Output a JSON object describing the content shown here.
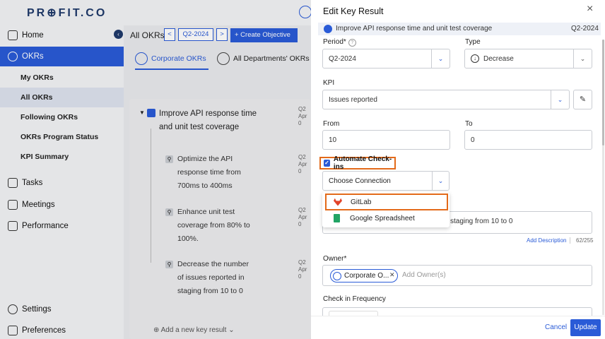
{
  "brand": {
    "logo": "PR⊕FIT.CO"
  },
  "sidebar": {
    "items": [
      {
        "label": "Home",
        "icon": "home-icon"
      },
      {
        "label": "OKRs",
        "icon": "target-icon",
        "active": true
      },
      {
        "label": "Tasks",
        "icon": "tasks-icon"
      },
      {
        "label": "Meetings",
        "icon": "calendar-icon"
      },
      {
        "label": "Performance",
        "icon": "chart-icon"
      },
      {
        "label": "Settings",
        "icon": "gear-icon"
      },
      {
        "label": "Preferences",
        "icon": "sliders-icon"
      }
    ],
    "sub_items": [
      "My OKRs",
      "All OKRs",
      "Following OKRs",
      "OKRs Program Status",
      "KPI Summary"
    ],
    "selected_sub": "All OKRs"
  },
  "main": {
    "title": "All OKRs",
    "prev": "<",
    "quarter": "Q2-2024",
    "next": ">",
    "create_label": "+ Create Objective",
    "tabs": [
      "Corporate OKRs",
      "All Departments' OKRs"
    ],
    "objective": "Improve API response time and unit test coverage",
    "key_results": [
      "Optimize the API response time from 700ms to 400ms",
      "Enhance unit test coverage from 80% to 100%.",
      "Decrease the number of issues reported in staging from 10 to 0"
    ],
    "quarter_short": "Q2",
    "date_short": "Apr 0",
    "add_kr": "Add a new key result"
  },
  "modal": {
    "title": "Edit Key Result",
    "close": "×",
    "context_objective": "Improve API response time and unit test coverage",
    "context_quarter": "Q2-2024",
    "period_label": "Period*",
    "period_value": "Q2-2024",
    "type_label": "Type",
    "type_value": "Decrease",
    "kpi_label": "KPI",
    "kpi_value": "Issues reported",
    "from_label": "From",
    "from_value": "10",
    "to_label": "To",
    "to_value": "0",
    "automate_label": "Automate Check-ins",
    "automate_checked": true,
    "connection_placeholder": "Choose Connection",
    "connection_options": [
      "GitLab",
      "Google Spreadsheet"
    ],
    "description_partial": "staging from 10 to 0",
    "add_description": "Add Description",
    "description_count": "62/255",
    "owner_label": "Owner*",
    "owner_chip": "Corporate O...",
    "owner_placeholder": "Add Owner(s)",
    "frequency_label": "Check in Frequency",
    "cancel_label": "Cancel",
    "update_label": "Update"
  },
  "colors": {
    "accent": "#2a5bd7",
    "highlight": "#e36a1a",
    "brand_dark": "#1f3a6b"
  }
}
